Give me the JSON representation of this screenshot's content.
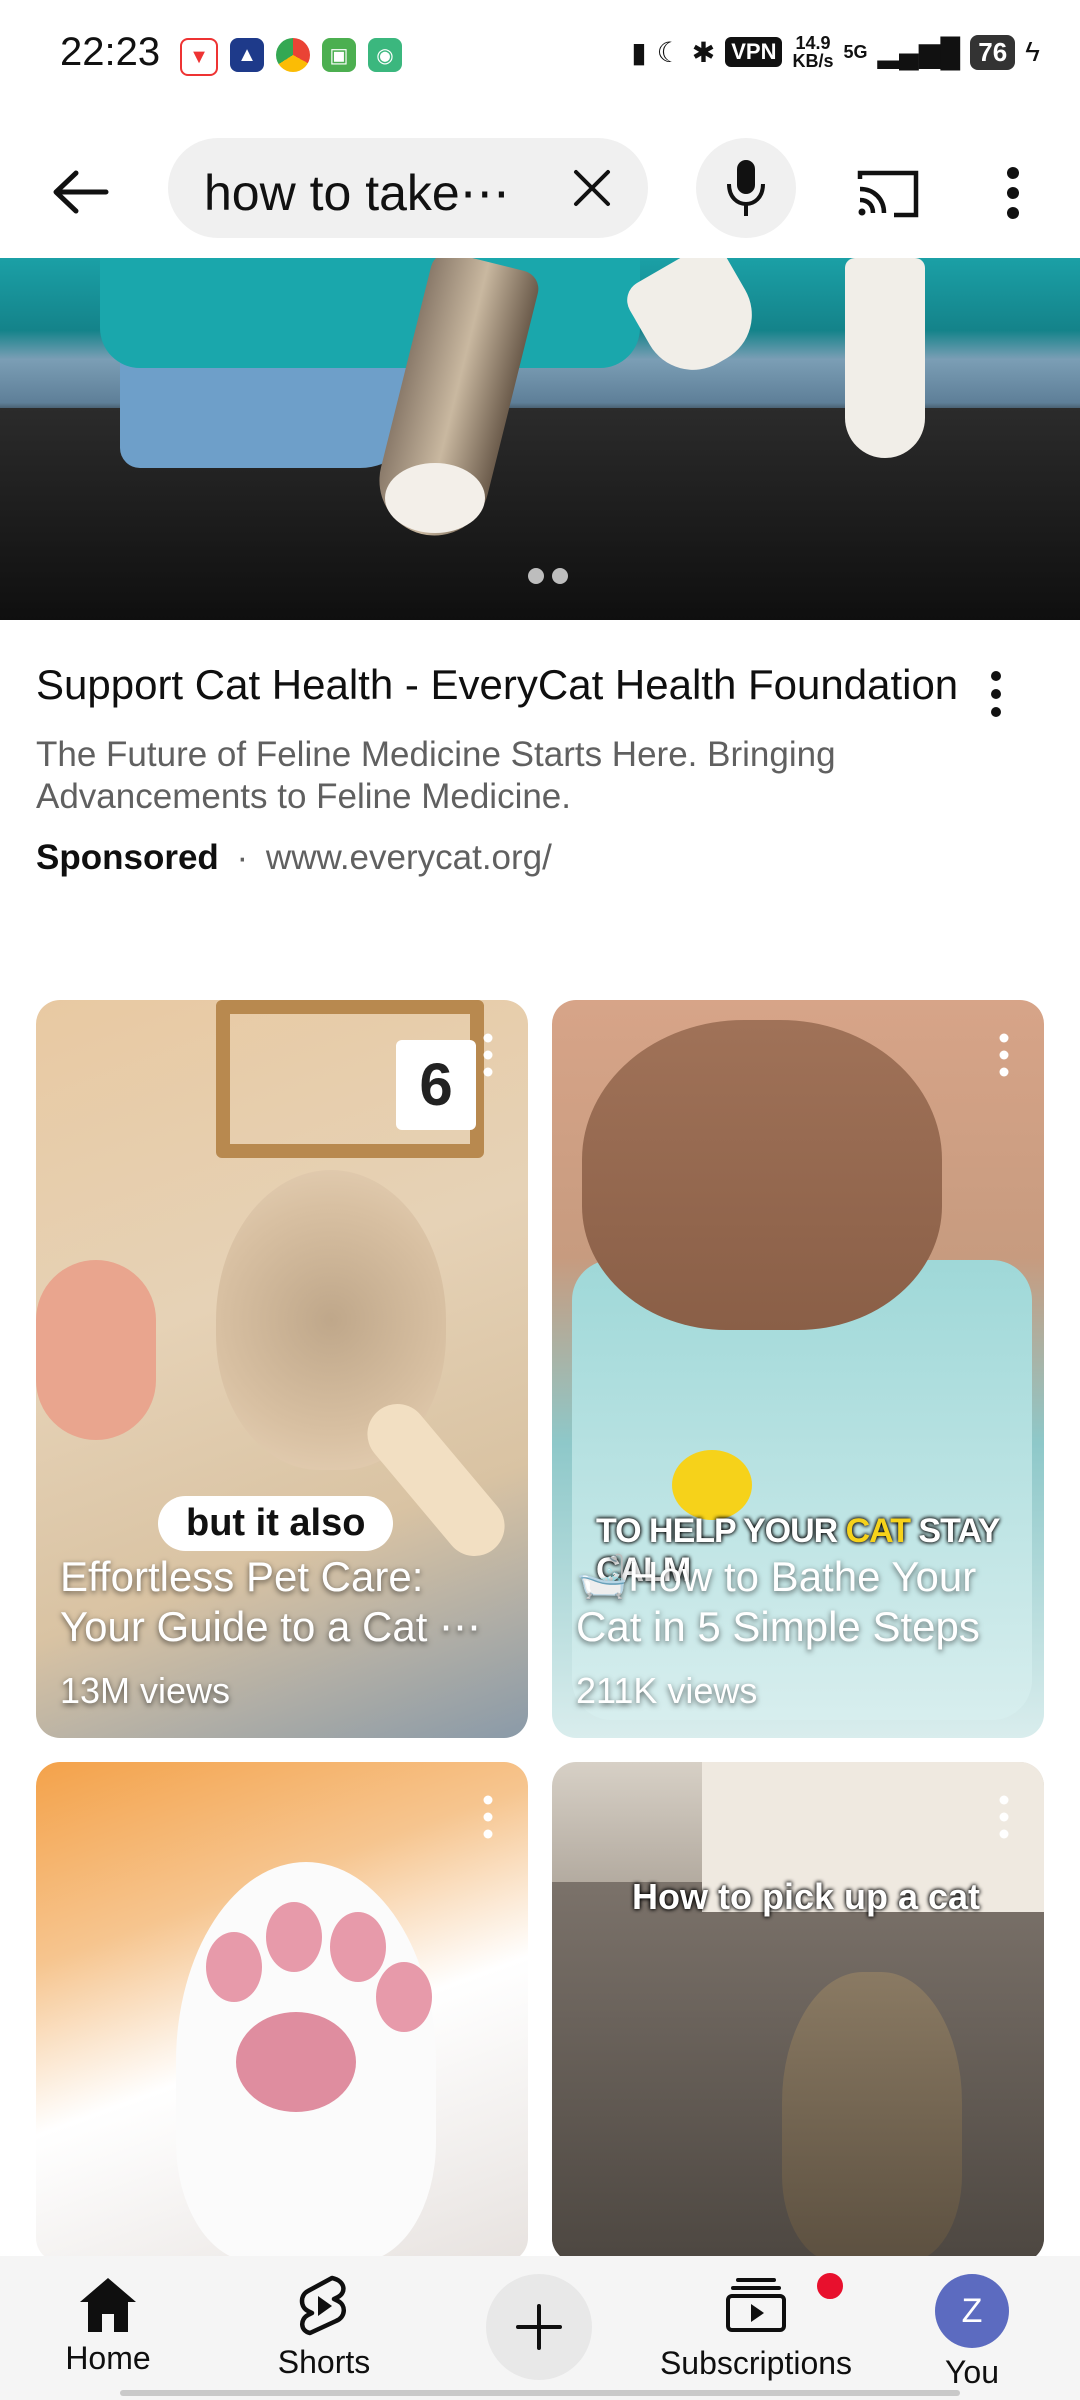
{
  "status_bar": {
    "time": "22:23",
    "vpn": "VPN",
    "speed_value": "14.9",
    "speed_unit": "KB/s",
    "network": "5G",
    "battery": "76"
  },
  "search": {
    "query": "how to take⋯"
  },
  "ad": {
    "title": "Support Cat Health - EveryCat Health Foundation",
    "description": "The Future of Feline Medicine Starts Here. Bringing Advancements to Feline Medicine.",
    "sponsored_label": "Sponsored",
    "separator": "·",
    "url": "www.everycat.org/"
  },
  "shorts": [
    {
      "overlay_text": "but it also",
      "sign_number": "6",
      "title": "Effortless Pet Care: Your Guide to a Cat ⋯",
      "views": "13M views"
    },
    {
      "overlay_text_part1": "TO HELP YOUR ",
      "overlay_text_highlight": "CAT",
      "overlay_text_part2": " STAY CALM",
      "title": "🛁How to Bathe Your Cat in 5 Simple Steps",
      "views": "211K views"
    },
    {},
    {
      "overlay_text": "How to pick up a cat"
    }
  ],
  "bottom_nav": {
    "home": "Home",
    "shorts": "Shorts",
    "subscriptions": "Subscriptions",
    "you": "You",
    "avatar_initial": "Z"
  },
  "colors": {
    "accent_red": "#e8102d",
    "avatar_bg": "#5c6bc0"
  }
}
